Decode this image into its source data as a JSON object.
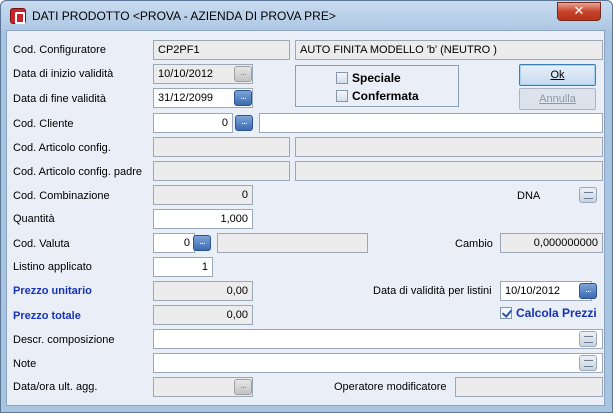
{
  "window": {
    "title": "DATI PRODOTTO <PROVA - AZIENDA DI PROVA PRE>",
    "close_glyph": "✕"
  },
  "fields": {
    "cod_configuratore": {
      "label": "Cod. Configuratore",
      "value": "CP2PF1",
      "description": "AUTO FINITA MODELLO 'b' (NEUTRO )"
    },
    "data_inizio": {
      "label": "Data di inizio validità",
      "value": "10/10/2012"
    },
    "data_fine": {
      "label": "Data di fine validità",
      "value": "31/12/2099"
    },
    "cod_cliente": {
      "label": "Cod. Cliente",
      "value": "0",
      "description": ""
    },
    "cod_articolo": {
      "label": "Cod. Articolo config.",
      "value": "",
      "description": ""
    },
    "cod_articolo_padre": {
      "label": "Cod. Articolo config. padre",
      "value": "",
      "description": ""
    },
    "cod_combinazione": {
      "label": "Cod. Combinazione",
      "value": "0"
    },
    "dna": {
      "label": "DNA"
    },
    "quantita": {
      "label": "Quantità",
      "value": "1,000"
    },
    "cod_valuta": {
      "label": "Cod. Valuta",
      "value": "0",
      "description": ""
    },
    "cambio": {
      "label": "Cambio",
      "value": "0,000000000"
    },
    "listino": {
      "label": "Listino applicato",
      "value": "1"
    },
    "prezzo_unitario": {
      "label": "Prezzo unitario",
      "value": "0,00"
    },
    "data_validita_listini": {
      "label": "Data di validità per listini",
      "value": "10/10/2012"
    },
    "prezzo_totale": {
      "label": "Prezzo totale",
      "value": "0,00"
    },
    "descr_composizione": {
      "label": "Descr. composizione",
      "value": ""
    },
    "note": {
      "label": "Note",
      "value": ""
    },
    "data_ora_agg": {
      "label": "Data/ora ult. agg.",
      "value": ""
    },
    "operatore": {
      "label": "Operatore modificatore",
      "value": ""
    }
  },
  "options": {
    "speciale": {
      "label": "Speciale",
      "checked": false
    },
    "confermata": {
      "label": "Confermata",
      "checked": false
    },
    "calcola_prezzi": {
      "label": "Calcola Prezzi",
      "checked": true
    }
  },
  "buttons": {
    "ok": "Ok",
    "annulla": "Annulla",
    "ellipsis": "..."
  },
  "icons": {
    "ellipsis": "ellipsis-icon",
    "list": "list-icon",
    "app": "app-icon",
    "close": "close-icon"
  },
  "colors": {
    "accent_blue": "#1632b8",
    "button_blue": "#3c6bb0",
    "close_red": "#c8432b"
  }
}
